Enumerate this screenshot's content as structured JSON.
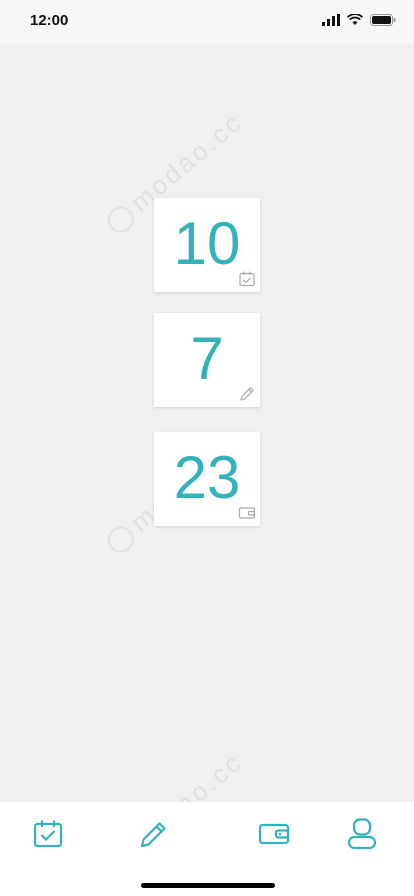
{
  "status": {
    "time": "12:00"
  },
  "watermark": {
    "text": "modao.cc"
  },
  "cards": [
    {
      "value": "10",
      "icon": "calendar-check-icon"
    },
    {
      "value": "7",
      "icon": "pencil-icon"
    },
    {
      "value": "23",
      "icon": "wallet-icon"
    }
  ],
  "tabbar": {
    "items": [
      "calendar-check-icon",
      "pencil-icon",
      "wallet-icon",
      "user-icon"
    ]
  },
  "colors": {
    "accent": "#33b2bc",
    "background": "#f0f0f0",
    "card": "#ffffff"
  }
}
